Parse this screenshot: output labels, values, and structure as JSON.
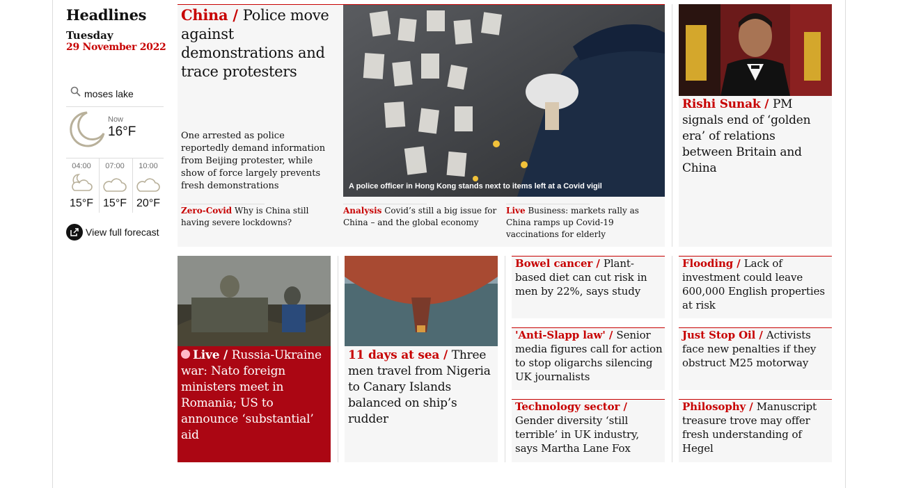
{
  "sidebar": {
    "title": "Headlines",
    "day": "Tuesday",
    "date": "29 November 2022",
    "location": "moses lake",
    "now_label": "Now",
    "now_temp": "16°F",
    "forecast": [
      {
        "time": "04:00",
        "temp": "15°F",
        "icon": "partly-cloudy-night-icon"
      },
      {
        "time": "07:00",
        "temp": "15°F",
        "icon": "cloud-icon"
      },
      {
        "time": "10:00",
        "temp": "20°F",
        "icon": "cloud-icon"
      }
    ],
    "full_forecast": "View full forecast"
  },
  "top_story": {
    "kicker": "China",
    "headline": "Police move against demonstrations and trace protesters",
    "standfirst": "One arrested as police reportedly demand information from Beijing protester, while show of force largely prevents fresh demonstrations",
    "caption": "A police officer in Hong Kong stands next to items left at a Covid vigil",
    "sublinks": [
      {
        "kicker": "Zero-Covid",
        "text": "Why is China still having severe lockdowns?"
      },
      {
        "kicker": "Analysis",
        "text": "Covid’s still a big issue for China – and the global economy"
      },
      {
        "kicker": "Live",
        "text": "Business: markets rally as China ramps up Covid-19 vaccinations for elderly"
      }
    ]
  },
  "right_top": {
    "kicker": "Rishi Sunak",
    "headline": "PM signals end of ‘golden era’ of relations between Britain and China"
  },
  "cards": {
    "ukraine": {
      "kicker": "Live",
      "headline": "Russia-Ukraine war: Nato foreign ministers meet in Romania; US to announce ‘substantial’ aid"
    },
    "sea": {
      "kicker": "11 days at sea",
      "headline": "Three men travel from Nigeria to Canary Islands balanced on ship’s rudder"
    },
    "bowel": {
      "kicker": "Bowel cancer",
      "headline": "Plant-based diet can cut risk in men by 22%, says study"
    },
    "slapp": {
      "kicker": "'Anti-Slapp law'",
      "headline": "Senior media figures call for action to stop oligarchs silencing UK journalists"
    },
    "tech": {
      "kicker": "Technology sector",
      "headline": "Gender diversity ‘still terrible’ in UK industry, says Martha Lane Fox"
    },
    "flooding": {
      "kicker": "Flooding",
      "headline": "Lack of investment could leave 600,000 English properties at risk"
    },
    "jso": {
      "kicker": "Just Stop Oil",
      "headline": "Activists face new penalties if they obstruct M25 motorway"
    },
    "philosophy": {
      "kicker": "Philosophy",
      "headline": "Manuscript treasure trove may offer fresh understanding of Hegel"
    }
  },
  "colors": {
    "accent": "#c70000",
    "live_bg": "#ab0613",
    "card_bg": "#f6f6f6"
  }
}
